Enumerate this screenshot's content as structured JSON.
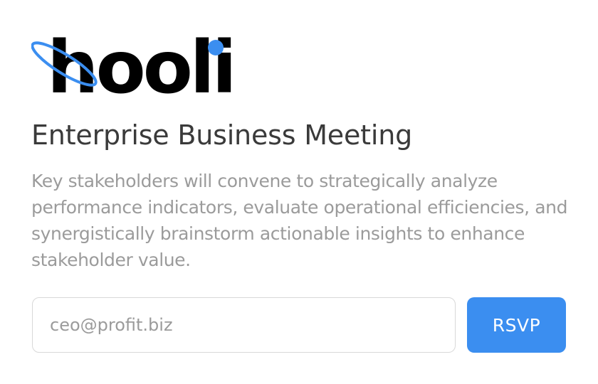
{
  "brand": {
    "logo_text": "hooli"
  },
  "event": {
    "title": "Enterprise Business Meeting",
    "description": "Key stakeholders will convene to strategically analyze performance indicators, evaluate operational efficiencies, and synergistically brainstorm actionable insights to enhance stakeholder value."
  },
  "form": {
    "email_placeholder": "ceo@profit.biz",
    "email_value": "",
    "submit_label": "RSVP"
  },
  "colors": {
    "accent": "#3b8ef0",
    "title_text": "#3a3a3a",
    "muted_text": "#9b9b9b",
    "input_border": "#d8d8d8"
  }
}
